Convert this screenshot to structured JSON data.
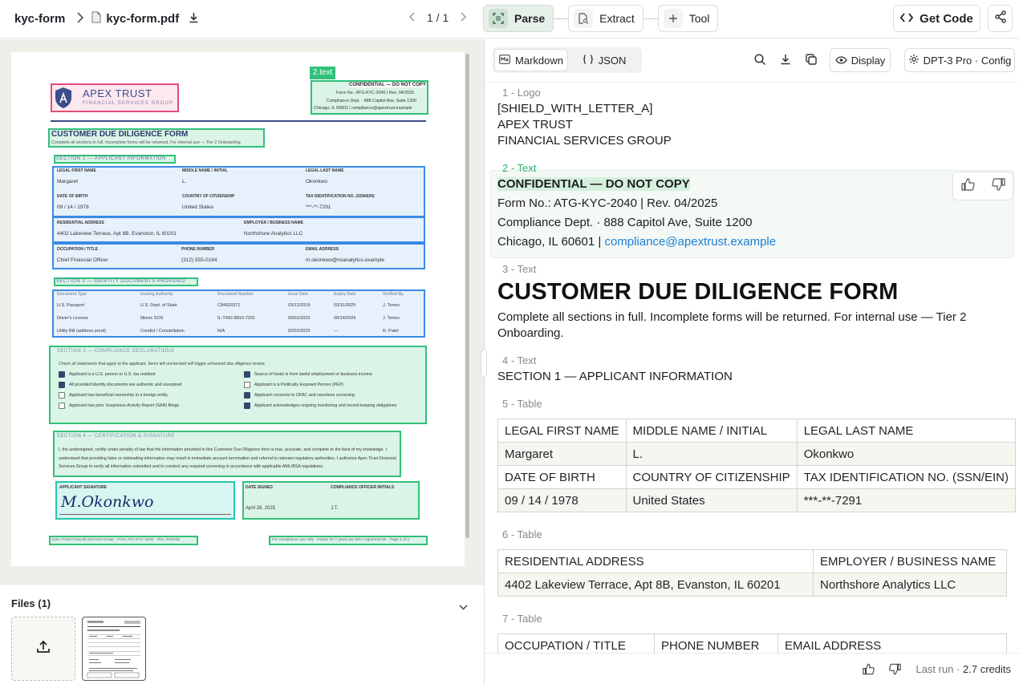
{
  "header": {
    "project": "kyc-form",
    "file_name": "kyc-form.pdf",
    "page_indicator": "1 / 1",
    "tabs": [
      {
        "label": "Parse",
        "icon": "scan-icon"
      },
      {
        "label": "Extract",
        "icon": "document-search-icon"
      },
      {
        "label": "Tool",
        "icon": "plus-icon"
      }
    ],
    "get_code_label": "Get Code"
  },
  "files": {
    "title": "Files (1)"
  },
  "right_toolbar": {
    "markdown_label": "Markdown",
    "json_label": "JSON",
    "display_label": "Display",
    "config_label": "DPT-3 Pro · Config"
  },
  "blocks": {
    "b1": {
      "label": "1 - Logo",
      "lines": [
        "[SHIELD_WITH_LETTER_A]",
        "APEX TRUST",
        "FINANCIAL SERVICES GROUP"
      ]
    },
    "b2": {
      "label": "2 - Text",
      "heading": "CONFIDENTIAL — DO NOT COPY",
      "line1": "Form No.: ATG-KYC-2040 | Rev. 04/2025",
      "line2": "Compliance Dept. · 888 Capitol Ave, Suite 1200",
      "line3_prefix": "Chicago, IL 60601 | ",
      "email": "compliance@apextrust.example"
    },
    "b3": {
      "label": "3 - Text",
      "title": "CUSTOMER DUE DILIGENCE FORM",
      "body": "Complete all sections in full. Incomplete forms will be returned. For internal use — Tier 2 Onboarding."
    },
    "b4": {
      "label": "4 - Text",
      "body": "SECTION 1 — APPLICANT INFORMATION"
    },
    "b5": {
      "label": "5 - Table",
      "rows": [
        [
          "LEGAL FIRST NAME",
          "MIDDLE NAME / INITIAL",
          "LEGAL LAST NAME"
        ],
        [
          "Margaret",
          "L.",
          "Okonkwo"
        ],
        [
          "DATE OF BIRTH",
          "COUNTRY OF CITIZENSHIP",
          "TAX IDENTIFICATION NO. (SSN/EIN)"
        ],
        [
          "09 / 14 / 1978",
          "United States",
          "***-**-7291"
        ]
      ]
    },
    "b6": {
      "label": "6 - Table",
      "rows": [
        [
          "RESIDENTIAL ADDRESS",
          "EMPLOYER / BUSINESS NAME"
        ],
        [
          "4402 Lakeview Terrace, Apt 8B, Evanston, IL 60201",
          "Northshore Analytics LLC"
        ]
      ]
    },
    "b7": {
      "label": "7 - Table",
      "rows": [
        [
          "OCCUPATION / TITLE",
          "PHONE NUMBER",
          "EMAIL ADDRESS"
        ]
      ]
    }
  },
  "footer": {
    "last_run_prefix": "Last run · ",
    "credits_value": "2.7",
    "credits_word": "credits"
  },
  "pdf": {
    "tag": "2.text",
    "brand": "APEX TRUST",
    "brand_sub": "FINANCIAL SERVICES GROUP",
    "conf_head": "CONFIDENTIAL — DO NOT COPY",
    "conf_l1": "Form No.: ATG-KYC-2040 | Rev. 04/2025",
    "conf_l2": "Compliance Dept. · 888 Capitol Ave, Suite 1200",
    "conf_l3": "Chicago, IL 60601 | compliance@apextrust.example",
    "title": "CUSTOMER DUE DILIGENCE FORM",
    "subtitle": "Complete all sections in full. Incomplete forms will be returned. For internal use — Tier 2 Onboarding.",
    "s1": "SECTION 1 — APPLICANT INFORMATION",
    "f_first": "LEGAL FIRST NAME",
    "v_first": "Margaret",
    "f_middle": "MIDDLE NAME / INITIAL",
    "v_middle": "L.",
    "f_last": "LEGAL LAST NAME",
    "v_last": "Okonkwo",
    "f_dob": "DATE OF BIRTH",
    "v_dob": "09 / 14 / 1978",
    "f_cit": "COUNTRY OF CITIZENSHIP",
    "v_cit": "United States",
    "f_tax": "TAX IDENTIFICATION NO. (SSN/EIN)",
    "v_tax": "***-**-7291",
    "f_addr": "RESIDENTIAL ADDRESS",
    "v_addr": "4402 Lakeview Terrace, Apt 8B, Evanston, IL 60201",
    "f_emp": "EMPLOYER / BUSINESS NAME",
    "v_emp": "Northshore Analytics LLC",
    "f_occ": "OCCUPATION / TITLE",
    "v_occ": "Chief Financial Officer",
    "f_phone": "PHONE NUMBER",
    "v_phone": "(312) 555-0184",
    "f_email": "EMAIL ADDRESS",
    "v_email": "m.okonkwo@nsanalytics.example",
    "s2": "SECTION 2 — IDENTITY DOCUMENTS PROVIDED",
    "doc_headers": [
      "Document Type",
      "Issuing Authority",
      "Document Number",
      "Issue Date",
      "Expiry Date",
      "Verified By"
    ],
    "doc_rows": [
      [
        "U.S. Passport",
        "U.S. Dept. of State",
        "C84920371",
        "03/12/2019",
        "03/11/2029",
        "J. Torres"
      ],
      [
        "Driver's License",
        "Illinois SOS",
        "IL-T492-8810-7291",
        "09/01/2022",
        "09/14/2026",
        "J. Torres"
      ],
      [
        "Utility Bill (address proof)",
        "ComEd / Constellation",
        "N/A",
        "02/01/2025",
        "—",
        "R. Patel"
      ]
    ],
    "s3": "SECTION 3 — COMPLIANCE DECLARATIONS",
    "s3_note": "Check all statements that apply to the applicant. Items left unchecked will trigger enhanced due diligence review.",
    "decl_left": [
      {
        "text": "Applicant is a U.S. person or U.S. tax resident",
        "checked": true
      },
      {
        "text": "All provided identity documents are authentic and unexpired",
        "checked": true
      },
      {
        "text": "Applicant has beneficial ownership in a foreign entity",
        "checked": false
      },
      {
        "text": "Applicant has prior Suspicious Activity Report (SAR) filings",
        "checked": false
      }
    ],
    "decl_right": [
      {
        "text": "Source of funds is from lawful employment or business income",
        "checked": true
      },
      {
        "text": "Applicant is a Politically Exposed Person (PEP)",
        "checked": false
      },
      {
        "text": "Applicant consents to OFAC and sanctions screening",
        "checked": true
      },
      {
        "text": "Applicant acknowledges ongoing monitoring and record-keeping obligations",
        "checked": true
      }
    ],
    "s4": "SECTION 4 — CERTIFICATION & SIGNATURE",
    "cert": "I, the undersigned, certify under penalty of law that the information provided in this Customer Due Diligence form is true, accurate, and complete to the best of my knowledge. I understand that providing false or misleading information may result in immediate account termination and referral to relevant regulatory authorities. I authorize Apex Trust Financial Services Group to verify all information submitted and to conduct any required screening in accordance with applicable AML/BSA regulations.",
    "f_sig": "APPLICANT SIGNATURE",
    "signature": "M.Okonkwo",
    "f_date": "DATE SIGNED",
    "v_date": "April 28, 2025",
    "f_init": "COMPLIANCE OFFICER INITIALS",
    "v_init": "J.T.",
    "foot_left": "Apex Trust Financial Services Group · Form ATG-KYC-2040 · Rev. 04/2025",
    "foot_right": "For compliance use only · Retain for 7 years per BSA requirements · Page 1 of 1"
  }
}
